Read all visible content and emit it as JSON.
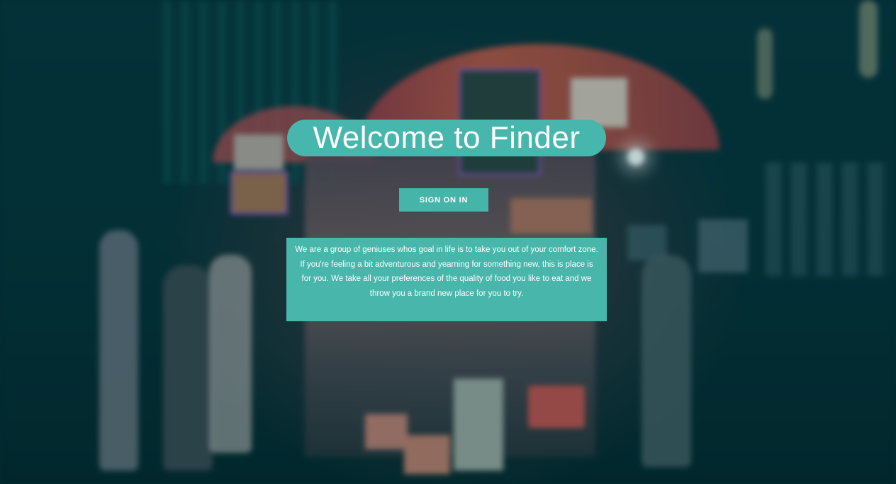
{
  "hero": {
    "title": "Welcome to Finder",
    "signin_label": "SIGN ON IN",
    "description": "We are a group of geniuses whos goal in life is to take you out of your comfort zone. If you're feeling a bit adventurous and yearning for something new, this is place is for you. We take all your preferences of the quality of food you like to eat and we throw you a brand new place for you to try."
  },
  "background": {
    "image": "blurred-night-street-food-cart-photo"
  },
  "colors": {
    "accent": "#47b7ad",
    "text": "#ffffff",
    "background": "#03222a"
  }
}
